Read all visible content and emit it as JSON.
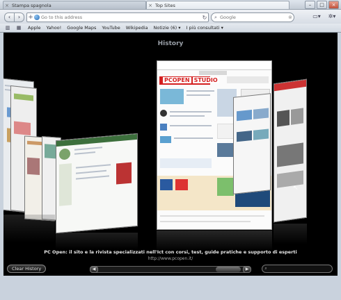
{
  "tabs": [
    {
      "title": "Stampa spagnola",
      "active": false
    },
    {
      "title": "Top Sites",
      "active": true
    }
  ],
  "toolbar": {
    "address_placeholder": "Go to this address",
    "search_placeholder": "Google"
  },
  "bookmarks": {
    "items": [
      "Apple",
      "Yahoo!",
      "Google Maps",
      "YouTube",
      "Wikipedia",
      "Notizie (6)",
      "I più consultati"
    ],
    "menu_suffix": "▾"
  },
  "history": {
    "title": "History",
    "caption": "PC Open: il sito e la rivista specializzati nell'Ict con corsi, test, guide pratiche e supporto di esperti",
    "url": "http://www.pcopen.it/",
    "clear_label": "Clear History",
    "featured_site_logo": "PCOPEN",
    "featured_site_logo_suffix": "STUDIO"
  },
  "colors": {
    "content_bg": "#000000",
    "chrome_bg": "#c9d2dd",
    "logo_red": "#d41f1f"
  },
  "icons": {
    "back": "back-arrow-icon",
    "forward": "forward-arrow-icon",
    "add": "plus-icon",
    "reload": "reload-icon",
    "search": "search-icon",
    "page": "page-menu-icon",
    "settings": "gear-icon"
  }
}
